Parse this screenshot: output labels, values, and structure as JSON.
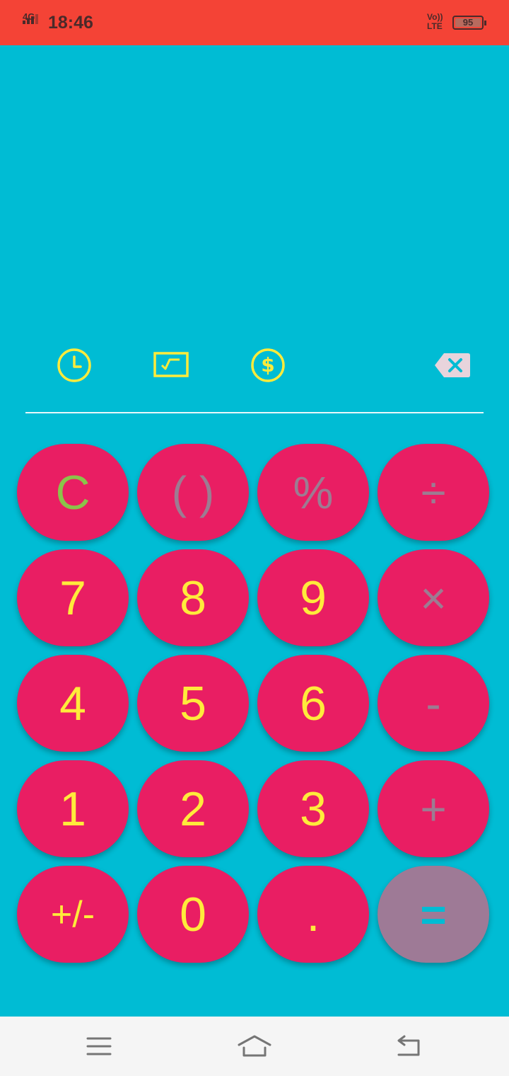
{
  "status_bar": {
    "network": "4G",
    "time": "18:46",
    "volte_line1": "Vo))",
    "volte_line2": "LTE",
    "battery": "95",
    "color": "#f44336"
  },
  "toolbar": {
    "icons": [
      "history-icon",
      "scientific-icon",
      "currency-icon",
      "backspace-icon"
    ]
  },
  "keypad": {
    "rows": [
      [
        "C",
        "( )",
        "%",
        "÷"
      ],
      [
        "7",
        "8",
        "9",
        "×"
      ],
      [
        "4",
        "5",
        "6",
        "-"
      ],
      [
        "1",
        "2",
        "3",
        "+"
      ],
      [
        "+/-",
        "0",
        ".",
        "="
      ]
    ]
  },
  "nav_bar": {
    "icons": [
      "menu-icon",
      "home-icon",
      "back-icon"
    ]
  },
  "colors": {
    "background": "#00bcd4",
    "key": "#e91e63",
    "digit_text": "#ffeb3b",
    "operator_text": "#9c7c92",
    "clear_text": "#8bc34a",
    "equals_key": "#9e7a96"
  }
}
